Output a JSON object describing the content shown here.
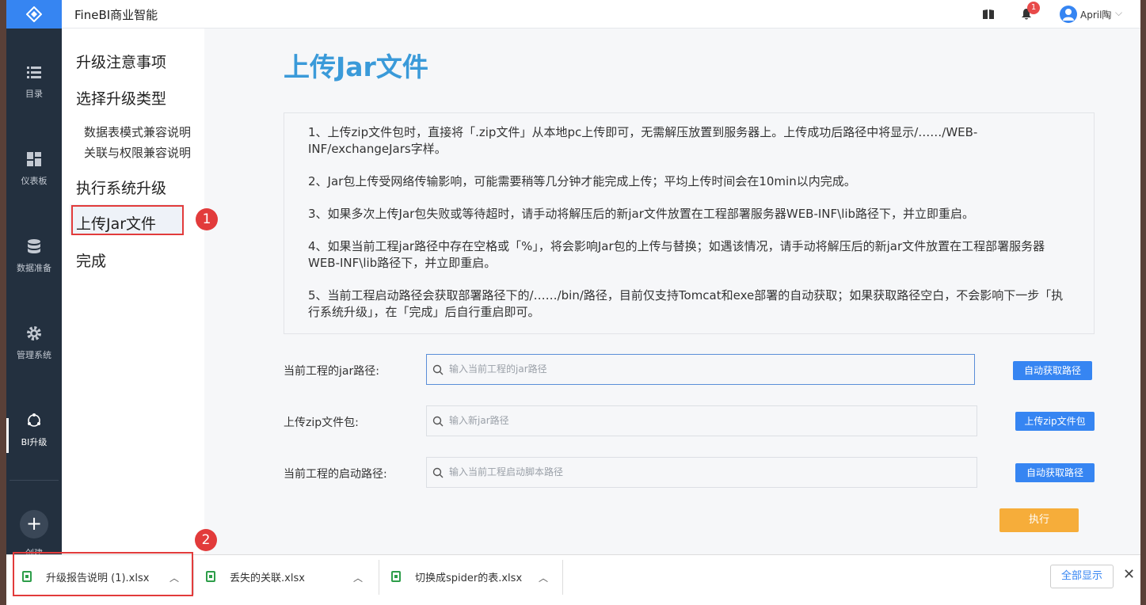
{
  "app": {
    "title": "FineBI商业智能"
  },
  "topbar": {
    "notification_count": "1",
    "user_name": "April陶"
  },
  "nav": {
    "items": [
      {
        "label": "目录",
        "icon": "list-icon"
      },
      {
        "label": "仪表板",
        "icon": "dashboard-icon"
      },
      {
        "label": "数据准备",
        "icon": "database-icon"
      },
      {
        "label": "管理系统",
        "icon": "gear-icon"
      },
      {
        "label": "BI升级",
        "icon": "upgrade-icon"
      }
    ],
    "create_label": "创建"
  },
  "steps": {
    "items": [
      "升级注意事项",
      "选择升级类型",
      "数据表模式兼容说明",
      "关联与权限兼容说明",
      "执行系统升级",
      "上传Jar文件",
      "完成"
    ],
    "active": "上传Jar文件"
  },
  "annotations": {
    "marker1": "1",
    "marker2": "2"
  },
  "main": {
    "title": "上传Jar文件",
    "notes": [
      "1、上传zip文件包时，直接将「.zip文件」从本地pc上传即可，无需解压放置到服务器上。上传成功后路径中将显示/……/WEB-INF/exchangeJars字样。",
      "2、Jar包上传受网络传输影响，可能需要稍等几分钟才能完成上传；平均上传时间会在10min以内完成。",
      "3、如果多次上传Jar包失败或等待超时，请手动将解压后的新jar文件放置在工程部署服务器WEB-INF\\lib路径下，并立即重启。",
      "4、如果当前工程jar路径中存在空格或「%」，将会影响Jar包的上传与替换；如遇该情况，请手动将解压后的新jar文件放置在工程部署服务器WEB-INF\\lib路径下，并立即重启。",
      "5、当前工程启动路径会获取部署路径下的/……/bin/路径，目前仅支持Tomcat和exe部署的自动获取；如果获取路径空白，不会影响下一步「执行系统升级」，在「完成」后自行重启即可。"
    ],
    "form": {
      "jar_path": {
        "label": "当前工程的jar路径:",
        "placeholder": "输入当前工程的jar路径",
        "button": "自动获取路径"
      },
      "zip_upload": {
        "label": "上传zip文件包:",
        "placeholder": "输入新jar路径",
        "button": "上传zip文件包"
      },
      "start_path": {
        "label": "当前工程的启动路径:",
        "placeholder": "输入当前工程启动脚本路径",
        "button": "自动获取路径"
      }
    },
    "execute_label": "执行"
  },
  "downloads": {
    "files": [
      "升级报告说明 (1).xlsx",
      "丢失的关联.xlsx",
      "切换成spider的表.xlsx"
    ],
    "show_all": "全部显示"
  },
  "colors": {
    "accent": "#3685f2",
    "nav_bg": "#23303f",
    "title": "#3a9ad9",
    "execute": "#f6ad3a",
    "annotation": "#e23b3b"
  }
}
